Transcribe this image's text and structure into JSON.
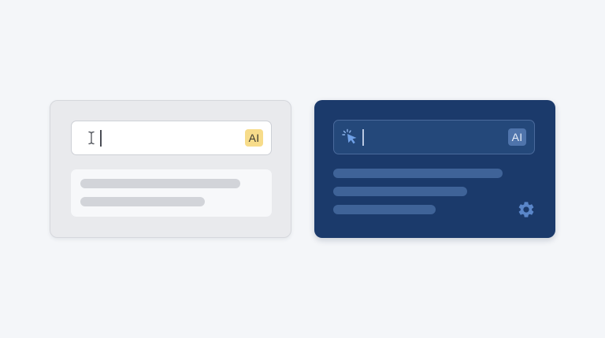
{
  "colors": {
    "page_background": "#f4f6f9",
    "light_card_background": "#e9eaed",
    "dark_card_background": "#1b3a6b",
    "dark_input_background": "#24487a",
    "light_ai_badge": "#f7dc8a",
    "dark_ai_badge": "#4f74ab",
    "pointer_accent": "#6fa0e6",
    "gear_color": "#5a86c9"
  },
  "light_panel": {
    "input": {
      "cursor_icon": "text-cursor-icon",
      "badge_label": "AI"
    },
    "results_placeholder_lines": 2
  },
  "dark_panel": {
    "input": {
      "cursor_icon": "click-pointer-icon",
      "badge_label": "AI"
    },
    "results_placeholder_lines": 3,
    "settings_icon": "gear-icon"
  }
}
